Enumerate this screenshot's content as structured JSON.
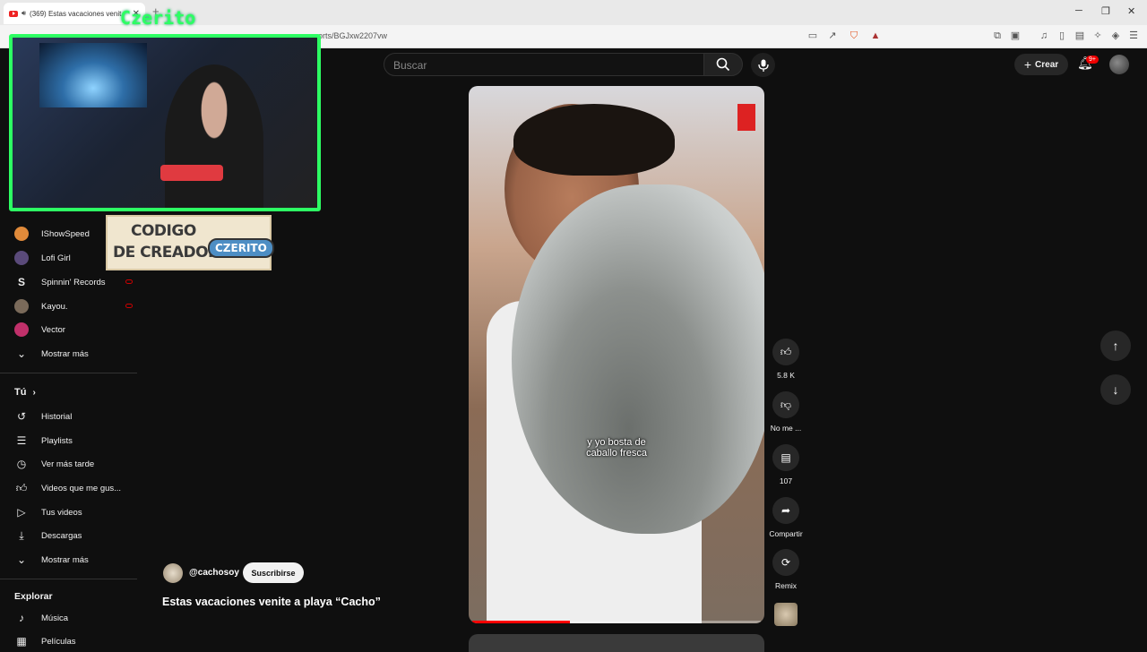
{
  "browser": {
    "tab_title": "(369) Estas vacaciones venit",
    "url": "orts/BGJxw2207vw",
    "newtab_symbol": "+"
  },
  "header": {
    "search_placeholder": "Buscar",
    "create_label": "Crear",
    "notifications_badge": "9+"
  },
  "overlay": {
    "streamer_name": "Czerito",
    "code_line1": "CODIGO",
    "code_line2": "DE CREADOR",
    "code_tag": "CZERITO"
  },
  "sidebar": {
    "subscriptions": [
      {
        "label": "IShowSpeed",
        "color": "#e08a3a"
      },
      {
        "label": "Lofi Girl",
        "color": "#5a4a7a"
      },
      {
        "label": "Spinnin' Records",
        "color": "#222222",
        "live": true
      },
      {
        "label": "Kayou.",
        "color": "#7a6a5a",
        "live": true
      },
      {
        "label": "Vector",
        "color": "#c0306a"
      }
    ],
    "show_more_1": "Mostrar más",
    "you_heading": "Tú",
    "you_items": [
      {
        "label": "Historial",
        "icon": "history-icon"
      },
      {
        "label": "Playlists",
        "icon": "playlists-icon"
      },
      {
        "label": "Ver más tarde",
        "icon": "clock-icon"
      },
      {
        "label": "Videos que me gus...",
        "icon": "thumbs-up-icon"
      },
      {
        "label": "Tus videos",
        "icon": "video-icon"
      },
      {
        "label": "Descargas",
        "icon": "download-icon"
      }
    ],
    "show_more_2": "Mostrar más",
    "explore_heading": "Explorar",
    "explore_items": [
      {
        "label": "Música",
        "icon": "music-icon"
      },
      {
        "label": "Películas",
        "icon": "film-icon"
      }
    ]
  },
  "video": {
    "caption_line1": "y yo bosta de",
    "caption_line2": "caballo fresca",
    "progress": 0.34,
    "channel_handle": "@cachosoy",
    "subscribe_label": "Suscribirse",
    "title": "Estas vacaciones venite a playa “Cacho”"
  },
  "actions": {
    "likes": "5.8 K",
    "dislike_label": "No me ...",
    "comments": "107",
    "share_label": "Compartir",
    "remix_label": "Remix"
  }
}
